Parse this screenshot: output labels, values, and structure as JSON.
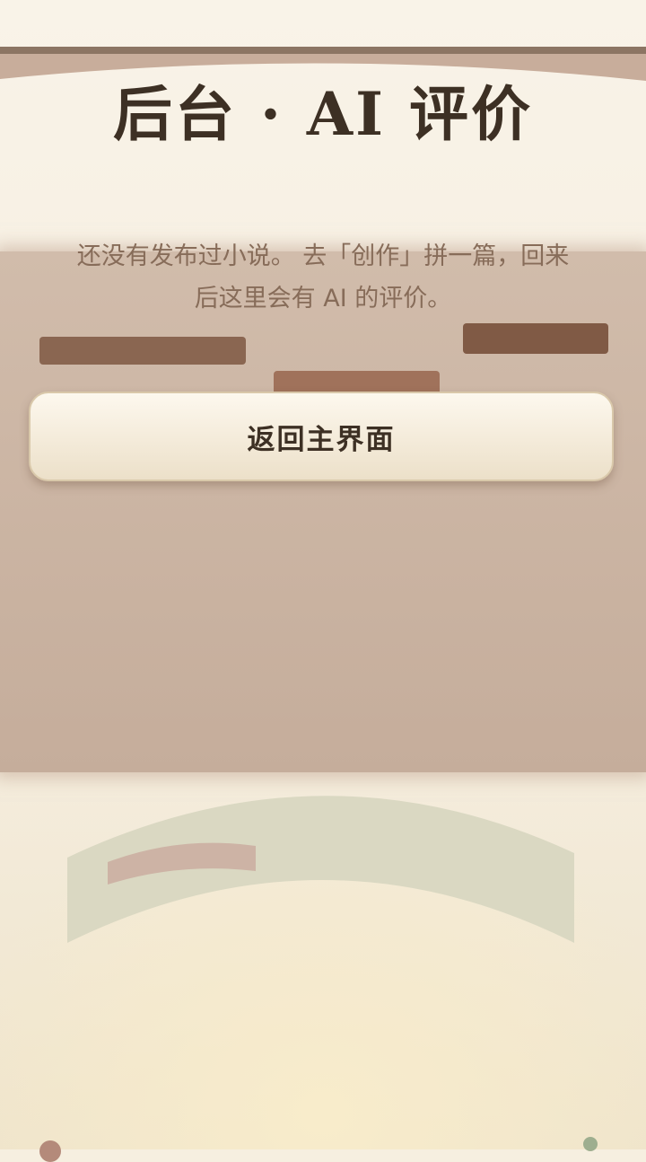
{
  "header": {
    "title": "后台 · AI 评价"
  },
  "empty_state": {
    "message_line1": "还没有发布过小说。 去「创作」拼一篇，回来",
    "message_line2": "后这里会有 AI 的评价。"
  },
  "actions": {
    "back_label": "返回主界面"
  },
  "colors": {
    "background": "#f6efe0",
    "panel": "#cbb5a3",
    "title_text": "#3d3024",
    "message_text": "#876c59",
    "button_face": "#f7f0e2"
  }
}
